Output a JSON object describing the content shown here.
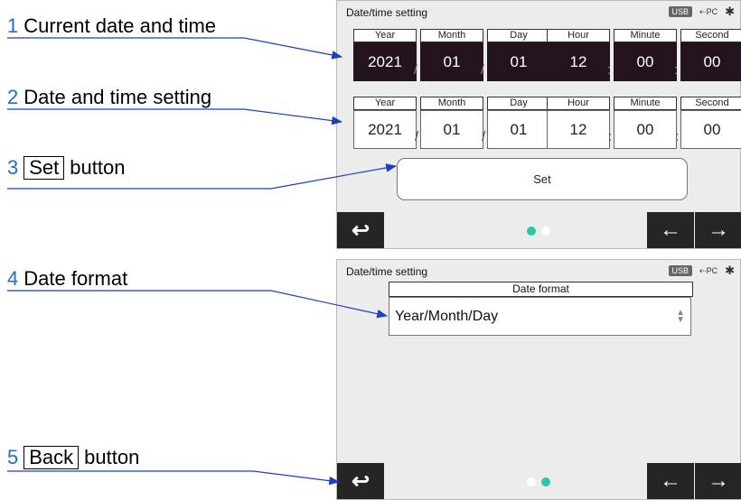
{
  "callouts": [
    {
      "num": "1",
      "text": "Current date and time"
    },
    {
      "num": "2",
      "text": "Date and time setting"
    },
    {
      "num": "3",
      "boxed": "Set",
      "text": "button"
    },
    {
      "num": "4",
      "text": "Date format"
    },
    {
      "num": "5",
      "boxed": "Back",
      "text": "button"
    }
  ],
  "screen": {
    "title": "Date/time setting",
    "status": {
      "usb": "USB",
      "pc": "PC"
    }
  },
  "date_labels": [
    "Year",
    "Month",
    "Day"
  ],
  "time_labels": [
    "Hour",
    "Minute",
    "Second"
  ],
  "current": {
    "year": "2021",
    "month": "01",
    "day": "01",
    "hour": "12",
    "minute": "00",
    "second": "00"
  },
  "setting": {
    "year": "2021",
    "month": "01",
    "day": "01",
    "hour": "12",
    "minute": "00",
    "second": "00"
  },
  "separators": {
    "date": "/",
    "time": ":"
  },
  "set_button": "Set",
  "date_format": {
    "header": "Date format",
    "value": "Year/Month/Day"
  },
  "colors": {
    "accent": "#2bc7a5",
    "dark_field": "#23131e",
    "callout_number": "#1f6fbf",
    "arrow": "#1f3fbf"
  },
  "pages": [
    {
      "dots": [
        true,
        false
      ]
    },
    {
      "dots": [
        false,
        true
      ]
    }
  ]
}
